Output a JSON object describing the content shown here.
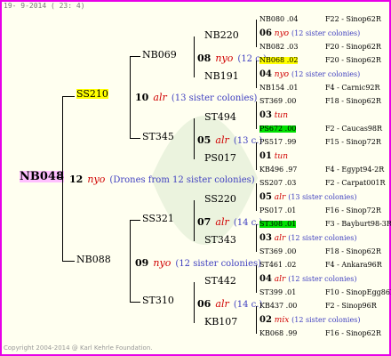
{
  "header": {
    "date": "19-  9-2014 ( 23:  4)"
  },
  "footer": {
    "copyright": "Copyright 2004-2014 @ Karl Kehrle Foundation."
  },
  "root": {
    "id": "NB048",
    "num": "12",
    "race": "nyo",
    "note": "(Drones from 12 sister colonies)"
  },
  "gen1": {
    "top": {
      "id": "SS210",
      "num": "10",
      "race": "alr",
      "note": "(13 sister colonies)"
    },
    "bottom": {
      "id": "NB088",
      "num": "09",
      "race": "nyo",
      "note": "(12 sister colonies)"
    }
  },
  "gen2": [
    {
      "id": "NB069",
      "num": "08",
      "race": "nyo",
      "note": "(12 c.)"
    },
    {
      "id": "ST345",
      "num": "05",
      "race": "alr",
      "note": "(13 c.)"
    },
    {
      "id": "SS321",
      "num": "07",
      "race": "alr",
      "note": "(14 c.)"
    },
    {
      "id": "ST310",
      "num": "06",
      "race": "alr",
      "note": "(14 c.)"
    }
  ],
  "gen3": [
    "NB220",
    "NB191",
    "ST494",
    "PS017",
    "SS220",
    "ST343",
    "ST442",
    "KB107"
  ],
  "gen4": [
    {
      "top": "NB080 .04",
      "topsrc": "F22 - Sinop62R",
      "mid_num": "06",
      "mid_race": "nyo",
      "mid_note": "(12 sister colonies)",
      "bot": "NB082 .03",
      "botsrc": "F20 - Sinop62R"
    },
    {
      "top": "NB068 .02",
      "topsrc": "F20 - Sinop62R",
      "mid_num": "04",
      "mid_race": "nyo",
      "mid_note": "(12 sister colonies)",
      "bot": "NB154 .01",
      "botsrc": "F4 - Carnic92R"
    },
    {
      "top": "ST369 .00",
      "topsrc": "F18 - Sinop62R",
      "mid_num": "03",
      "mid_race": "tun",
      "mid_note": "",
      "bot": "PS672 .00",
      "botsrc": "F2 - Caucas98R"
    },
    {
      "top": "PS517 .99",
      "topsrc": "F15 - Sinop72R",
      "mid_num": "01",
      "mid_race": "tun",
      "mid_note": "",
      "bot": "KB496 .97",
      "botsrc": "F4 - Egypt94-2R"
    },
    {
      "top": "SS207 .03",
      "topsrc": "F2 - Carpat001R",
      "mid_num": "05",
      "mid_race": "alr",
      "mid_note": "(13 sister colonies)",
      "bot": "PS017 .01",
      "botsrc": "F16 - Sinop72R"
    },
    {
      "top": "ST308 .01",
      "topsrc": "F3 - Bayburt98-3R",
      "mid_num": "03",
      "mid_race": "alr",
      "mid_note": "(12 sister colonies)",
      "bot": "ST369 .00",
      "botsrc": "F18 - Sinop62R"
    },
    {
      "top": "ST461 .02",
      "topsrc": "F4 - Ankara96R",
      "mid_num": "04",
      "mid_race": "alr",
      "mid_note": "(12 sister colonies)",
      "bot": "ST399 .01",
      "botsrc": "F10 - SinopEgg86R"
    },
    {
      "top": "KB437 .00",
      "topsrc": "F2 - Sinop96R",
      "mid_num": "02",
      "mid_race": "mix",
      "mid_note": "(12 sister colonies)",
      "bot": "KB068 .99",
      "botsrc": "F16 - Sinop62R"
    }
  ]
}
